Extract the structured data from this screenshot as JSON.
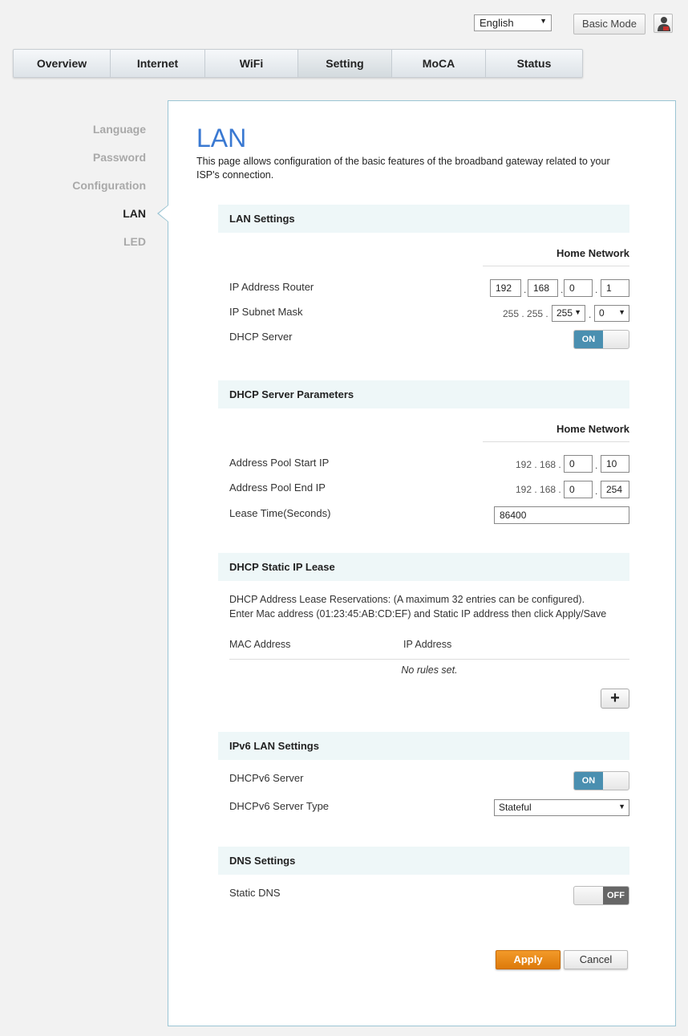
{
  "header": {
    "language": "English",
    "basic_mode": "Basic Mode",
    "user_icon": "user-admin-icon"
  },
  "tabs": [
    {
      "label": "Overview"
    },
    {
      "label": "Internet"
    },
    {
      "label": "WiFi"
    },
    {
      "label": "Setting",
      "active": true
    },
    {
      "label": "MoCA"
    },
    {
      "label": "Status"
    }
  ],
  "sidebar": {
    "items": [
      {
        "label": "Language"
      },
      {
        "label": "Password"
      },
      {
        "label": "Configuration"
      },
      {
        "label": "LAN",
        "active": true
      },
      {
        "label": "LED"
      }
    ]
  },
  "page": {
    "title": "LAN",
    "description": "This page allows configuration of the basic features of the broadband gateway related to your ISP's connection."
  },
  "lan_settings": {
    "heading": "LAN Settings",
    "column": "Home Network",
    "ip_router_label": "IP Address Router",
    "ip_router": [
      "192",
      "168",
      "0",
      "1"
    ],
    "subnet_label": "IP Subnet Mask",
    "subnet_fixed": "255 . 255 .",
    "subnet_sel3": "255",
    "subnet_sel4": "0",
    "dhcp_label": "DHCP Server",
    "dhcp_state": "ON"
  },
  "dhcp_params": {
    "heading": "DHCP Server Parameters",
    "column": "Home Network",
    "start_label": "Address Pool Start IP",
    "start_fixed": "192 . 168 .",
    "start_3": "0",
    "start_4": "10",
    "end_label": "Address Pool End IP",
    "end_fixed": "192 . 168 .",
    "end_3": "0",
    "end_4": "254",
    "lease_label": "Lease Time(Seconds)",
    "lease_value": "86400"
  },
  "static_lease": {
    "heading": "DHCP Static IP Lease",
    "info_line1": "DHCP Address Lease Reservations: (A maximum 32 entries can be configured).",
    "info_line2": "Enter Mac address (01:23:45:AB:CD:EF) and Static IP address then click Apply/Save",
    "col_mac": "MAC Address",
    "col_ip": "IP Address",
    "empty": "No rules set.",
    "add": "+"
  },
  "ipv6": {
    "heading": "IPv6 LAN Settings",
    "server_label": "DHCPv6 Server",
    "server_state": "ON",
    "type_label": "DHCPv6 Server Type",
    "type_value": "Stateful"
  },
  "dns": {
    "heading": "DNS Settings",
    "static_label": "Static DNS",
    "static_state": "OFF"
  },
  "actions": {
    "apply": "Apply",
    "cancel": "Cancel"
  },
  "colors": {
    "accent": "#3a79d2",
    "toggle_on": "#4a8fb0",
    "apply": "#e88a1a",
    "section_bg": "#eef7f8"
  }
}
